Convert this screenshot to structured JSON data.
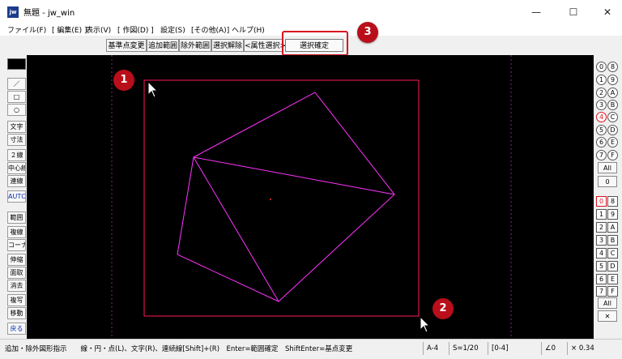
{
  "window": {
    "title": "無題 - jw_win",
    "app_icon_label": "jw",
    "minimize_glyph": "—",
    "maximize_glyph": "☐",
    "close_glyph": "✕"
  },
  "menu": [
    {
      "label": "ファイル(F)"
    },
    {
      "label": "[ 編集(E) ]"
    },
    {
      "label": "表示(V)"
    },
    {
      "label": "[ 作図(D) ]"
    },
    {
      "label": "設定(S)"
    },
    {
      "label": "[その他(A)]"
    },
    {
      "label": "ヘルプ(H)"
    }
  ],
  "toolbar": {
    "buttons": [
      {
        "label": "基準点変更"
      },
      {
        "label": "追加範囲"
      },
      {
        "label": "除外範囲"
      },
      {
        "label": "選択解除"
      },
      {
        "label": "<属性選択>"
      }
    ],
    "confirm_label": "選択確定"
  },
  "callouts": [
    "1",
    "2",
    "3"
  ],
  "left_tools": [
    {
      "label": "／"
    },
    {
      "label": "□"
    },
    {
      "label": "○"
    },
    {
      "label": "文字"
    },
    {
      "label": "寸法"
    },
    {
      "label": "２線"
    },
    {
      "label": "中心線"
    },
    {
      "label": "連線"
    },
    {
      "label": "AUTO"
    },
    {
      "label": "範囲"
    },
    {
      "label": "複線"
    },
    {
      "label": "コーナー"
    },
    {
      "label": "伸縮"
    },
    {
      "label": "面取"
    },
    {
      "label": "消去"
    },
    {
      "label": "複写"
    },
    {
      "label": "移動"
    },
    {
      "label": "戻る"
    }
  ],
  "right_top_pairs": [
    [
      "0",
      "8"
    ],
    [
      "1",
      "9"
    ],
    [
      "2",
      "A"
    ],
    [
      "3",
      "B"
    ],
    [
      "4",
      "C"
    ],
    [
      "5",
      "D"
    ],
    [
      "6",
      "E"
    ],
    [
      "7",
      "F"
    ]
  ],
  "right_top_wide": [
    "All",
    "0"
  ],
  "right_bottom_pairs": [
    [
      "0",
      "8"
    ],
    [
      "1",
      "9"
    ],
    [
      "2",
      "A"
    ],
    [
      "3",
      "B"
    ],
    [
      "4",
      "C"
    ],
    [
      "5",
      "D"
    ],
    [
      "6",
      "E"
    ],
    [
      "7",
      "F"
    ]
  ],
  "right_bottom_wide": [
    "All",
    "✕"
  ],
  "status": {
    "message": "追加・除外図形指示　　線・円・点(L)、文字(R)、連続線[Shift]+(R)　Enter=範囲確定　ShiftEnter=基点変更",
    "paper": "A-4",
    "scale": "S=1/20",
    "layer": "[0-4]",
    "angle": "∠0",
    "zoom": "× 0.34"
  },
  "colors": {
    "canvas": "#000000",
    "selection_rect": "#ff1a5a",
    "shape_lines": "#ff33ff",
    "callout": "#b80f1a",
    "highlight": "#d9121f"
  }
}
